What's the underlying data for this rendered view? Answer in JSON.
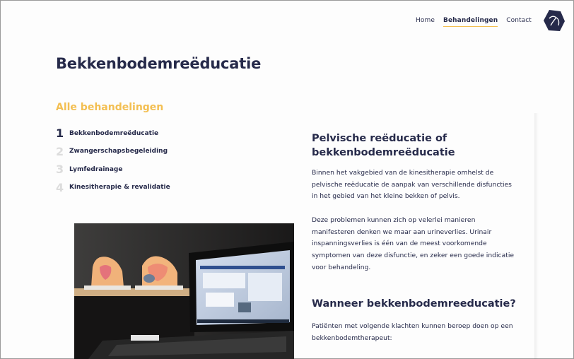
{
  "nav": {
    "items": [
      {
        "label": "Home",
        "active": false
      },
      {
        "label": "Behandelingen",
        "active": true
      },
      {
        "label": "Contact",
        "active": false
      }
    ]
  },
  "page": {
    "title": "Bekkenbodemreëducatie"
  },
  "treatments": {
    "heading": "Alle behandelingen",
    "items": [
      {
        "num": "1",
        "label": "Bekkenbodemreëducatie",
        "active": true
      },
      {
        "num": "2",
        "label": "Zwangerschapsbegeleiding",
        "active": false
      },
      {
        "num": "3",
        "label": "Lymfedrainage",
        "active": false
      },
      {
        "num": "4",
        "label": "Kinesitherapie & revalidatie",
        "active": false
      }
    ]
  },
  "content": {
    "section1_title": "Pelvische reëducatie of bekkenbodemreëducatie",
    "paragraph1": "Binnen het vakgebied van de kinesitherapie omhelst de pelvische reëducatie de aanpak van verschillende disfuncties in het gebied van het kleine bekken of pelvis.",
    "paragraph2": "Deze problemen kunnen zich op velerlei manieren manifesteren denken we maar aan urineverlies. Urinair inspanningsverlies is één van de meest voorkomende symptomen van deze disfunctie, en zeker een goede indicatie voor behandeling.",
    "section2_title": "Wanneer bekkenbodemreeducatie?",
    "paragraph3": "Patiënten met volgende klachten kunnen beroep doen op een bekkenbodemtherapeut:"
  },
  "colors": {
    "accent": "#f3bf52",
    "navy": "#262a4a"
  }
}
